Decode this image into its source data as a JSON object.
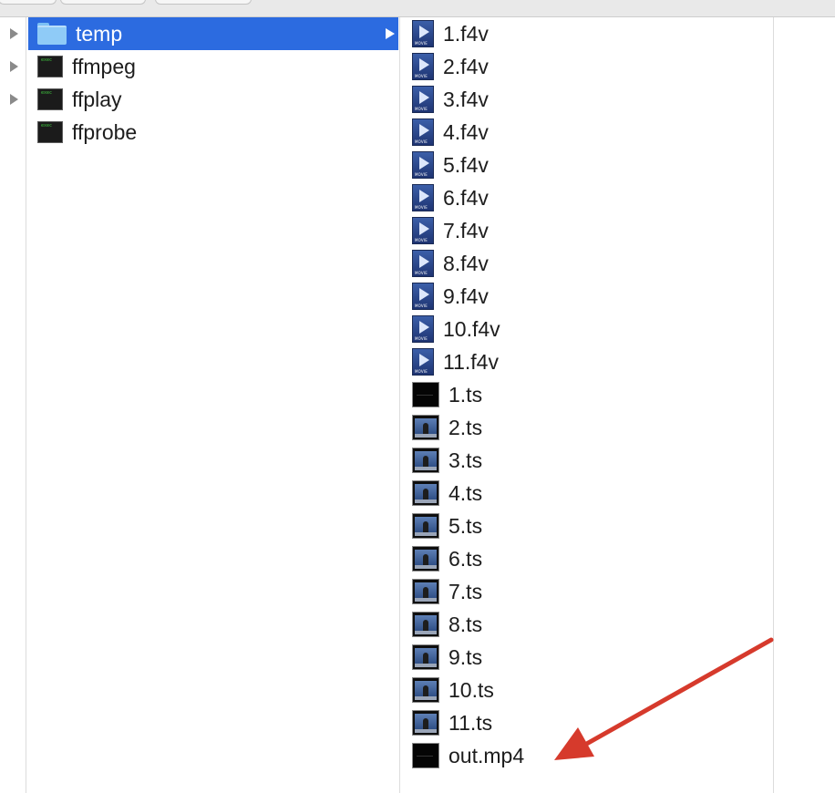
{
  "toolbar": {},
  "sidebar_column": {
    "items": [
      {
        "label": "temp",
        "icon": "folder-icon",
        "selected": true
      },
      {
        "label": "ffmpeg",
        "icon": "exec-icon"
      },
      {
        "label": "ffplay",
        "icon": "exec-icon"
      },
      {
        "label": "ffprobe",
        "icon": "exec-icon"
      }
    ]
  },
  "files": {
    "items": [
      {
        "label": "1.f4v",
        "icon": "movie-icon"
      },
      {
        "label": "2.f4v",
        "icon": "movie-icon"
      },
      {
        "label": "3.f4v",
        "icon": "movie-icon"
      },
      {
        "label": "4.f4v",
        "icon": "movie-icon"
      },
      {
        "label": "5.f4v",
        "icon": "movie-icon"
      },
      {
        "label": "6.f4v",
        "icon": "movie-icon"
      },
      {
        "label": "7.f4v",
        "icon": "movie-icon"
      },
      {
        "label": "8.f4v",
        "icon": "movie-icon"
      },
      {
        "label": "9.f4v",
        "icon": "movie-icon"
      },
      {
        "label": "10.f4v",
        "icon": "movie-icon"
      },
      {
        "label": "11.f4v",
        "icon": "movie-icon"
      },
      {
        "label": "1.ts",
        "icon": "video-thumbnail-dark-icon"
      },
      {
        "label": "2.ts",
        "icon": "video-thumbnail-icon"
      },
      {
        "label": "3.ts",
        "icon": "video-thumbnail-icon"
      },
      {
        "label": "4.ts",
        "icon": "video-thumbnail-icon"
      },
      {
        "label": "5.ts",
        "icon": "video-thumbnail-icon"
      },
      {
        "label": "6.ts",
        "icon": "video-thumbnail-icon"
      },
      {
        "label": "7.ts",
        "icon": "video-thumbnail-icon"
      },
      {
        "label": "8.ts",
        "icon": "video-thumbnail-icon"
      },
      {
        "label": "9.ts",
        "icon": "video-thumbnail-icon"
      },
      {
        "label": "10.ts",
        "icon": "video-thumbnail-icon"
      },
      {
        "label": "11.ts",
        "icon": "video-thumbnail-icon"
      },
      {
        "label": "out.mp4",
        "icon": "video-thumbnail-dark-icon"
      }
    ]
  },
  "icons": {
    "movie_tag": "MOVIE",
    "exec_text": "exec"
  },
  "colors": {
    "selection": "#2c6be0",
    "annotation_arrow": "#d63a2c"
  }
}
